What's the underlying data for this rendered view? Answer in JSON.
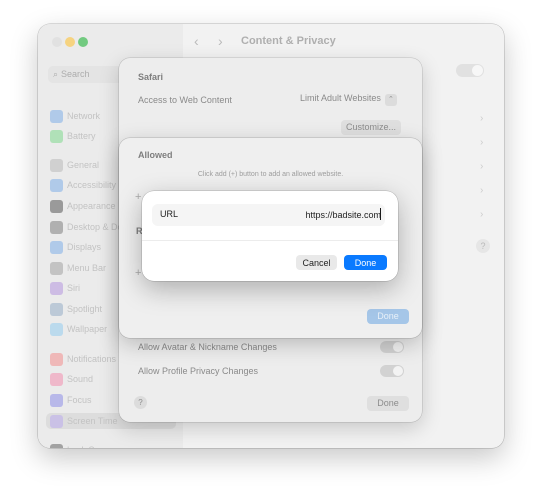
{
  "window": {
    "title": "Content & Privacy",
    "nav_back": "‹",
    "nav_forward": "›",
    "chevron": "›",
    "help": "?"
  },
  "sidebar": {
    "search_placeholder": "Search",
    "search_icon": "⌕",
    "items": [
      {
        "label": "Network",
        "color": "#8fb3e0"
      },
      {
        "label": "Battery",
        "color": "#8fd59a"
      },
      {
        "label": "General",
        "color": "#bcbcbc"
      },
      {
        "label": "Accessibility",
        "color": "#8fb3e0"
      },
      {
        "label": "Appearance",
        "color": "#6f6f6f"
      },
      {
        "label": "Desktop & Dock",
        "color": "#8f8f8f"
      },
      {
        "label": "Displays",
        "color": "#8fb3e0"
      },
      {
        "label": "Menu Bar",
        "color": "#a9a9a9"
      },
      {
        "label": "Siri",
        "color": "#b8a0d8"
      },
      {
        "label": "Spotlight",
        "color": "#9fb2c6"
      },
      {
        "label": "Wallpaper",
        "color": "#9ecae6"
      },
      {
        "label": "Notifications",
        "color": "#e99a9a"
      },
      {
        "label": "Sound",
        "color": "#e99ab4"
      },
      {
        "label": "Focus",
        "color": "#9a9ae0"
      },
      {
        "label": "Screen Time",
        "color": "#b3a6dc",
        "selected": true
      },
      {
        "label": "Lock Screen",
        "color": "#7a7a7a"
      }
    ]
  },
  "safari_sheet": {
    "title": "Safari",
    "access_label": "Access to Web Content",
    "access_value": "Limit Adult Websites",
    "stepper_icon": "⌃",
    "customize_label": "Customize...",
    "avatar_label": "Allow Avatar & Nickname Changes",
    "profile_label": "Allow Profile Privacy Changes",
    "help": "?",
    "done_label": "Done"
  },
  "allowed_sheet": {
    "title": "Allowed",
    "hint": "Click add (+) button to add an allowed website.",
    "add_icon": "+",
    "section_letter": "R",
    "done_label": "Done"
  },
  "url_dialog": {
    "label": "URL",
    "value": "https://badsite.com",
    "cancel_label": "Cancel",
    "done_label": "Done",
    "accent_color": "#0a7aff"
  }
}
